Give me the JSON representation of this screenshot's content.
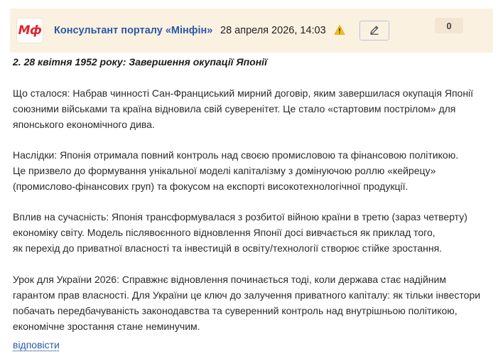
{
  "header": {
    "logo_text": "Мф",
    "author": "Консультант порталу «Мінфін»",
    "date": "28 апреля 2026, 14:03",
    "warning_icon": "warning-icon",
    "edit_icon": "pencil-icon",
    "vote_count": "0",
    "colors": {
      "header_bg": "#fbf1e1",
      "link": "#2b58a8",
      "logo": "#e1232b"
    }
  },
  "post": {
    "headline": "2. 28 квітня 1952 року: Завершення окупації Японії",
    "paragraphs": [
      {
        "lines": [
          "Що сталося: Набрав чинності Сан-Франциський мирний договір, яким завершилася окупація Японії",
          "союзними військами та країна відновила свій суверенітет. Це стало «стартовим пострілом» для",
          "японського економічного дива."
        ]
      },
      {
        "lines": [
          "Наслідки: Японія отримала повний контроль над своєю промисловою та фінансовою політикою.",
          "Це призвело до формування унікальної моделі капіталізму з домінуючою роллю «кейрецу»",
          "(промислово-фінансових груп) та фокусом на експорті високотехнологічної продукції."
        ]
      },
      {
        "lines": [
          "Вплив на сучасність: Японія трансформувалася з розбитої війною країни в третю (зараз четверту)",
          "економіку світу. Модель післявоєнного відновлення Японії досі вивчається як приклад того,",
          "як перехід до приватної власності та інвестицій в освіту/технології створює стійке зростання."
        ]
      },
      {
        "lines": [
          "Урок для України 2026: Справжнє відновлення починається тоді, коли держава стає надійним",
          "гарантом прав власності. Для України це ключ до залучення приватного капіталу: як тільки інвестори",
          "побачать передбачуваність законодавства та суверенний контроль над внутрішньою політикою,",
          "економічне зростання стане неминучим."
        ]
      }
    ]
  },
  "actions": {
    "reply_label": "відповісти"
  }
}
